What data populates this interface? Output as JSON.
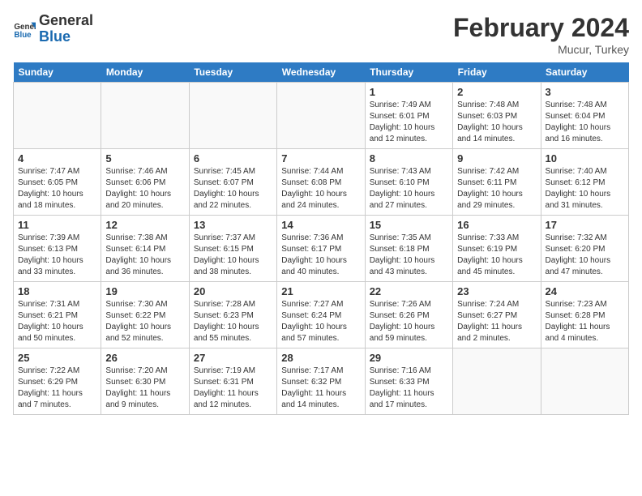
{
  "header": {
    "logo_line1": "General",
    "logo_line2": "Blue",
    "month_title": "February 2024",
    "subtitle": "Mucur, Turkey"
  },
  "days_of_week": [
    "Sunday",
    "Monday",
    "Tuesday",
    "Wednesday",
    "Thursday",
    "Friday",
    "Saturday"
  ],
  "weeks": [
    [
      {
        "day": "",
        "info": ""
      },
      {
        "day": "",
        "info": ""
      },
      {
        "day": "",
        "info": ""
      },
      {
        "day": "",
        "info": ""
      },
      {
        "day": "1",
        "info": "Sunrise: 7:49 AM\nSunset: 6:01 PM\nDaylight: 10 hours\nand 12 minutes."
      },
      {
        "day": "2",
        "info": "Sunrise: 7:48 AM\nSunset: 6:03 PM\nDaylight: 10 hours\nand 14 minutes."
      },
      {
        "day": "3",
        "info": "Sunrise: 7:48 AM\nSunset: 6:04 PM\nDaylight: 10 hours\nand 16 minutes."
      }
    ],
    [
      {
        "day": "4",
        "info": "Sunrise: 7:47 AM\nSunset: 6:05 PM\nDaylight: 10 hours\nand 18 minutes."
      },
      {
        "day": "5",
        "info": "Sunrise: 7:46 AM\nSunset: 6:06 PM\nDaylight: 10 hours\nand 20 minutes."
      },
      {
        "day": "6",
        "info": "Sunrise: 7:45 AM\nSunset: 6:07 PM\nDaylight: 10 hours\nand 22 minutes."
      },
      {
        "day": "7",
        "info": "Sunrise: 7:44 AM\nSunset: 6:08 PM\nDaylight: 10 hours\nand 24 minutes."
      },
      {
        "day": "8",
        "info": "Sunrise: 7:43 AM\nSunset: 6:10 PM\nDaylight: 10 hours\nand 27 minutes."
      },
      {
        "day": "9",
        "info": "Sunrise: 7:42 AM\nSunset: 6:11 PM\nDaylight: 10 hours\nand 29 minutes."
      },
      {
        "day": "10",
        "info": "Sunrise: 7:40 AM\nSunset: 6:12 PM\nDaylight: 10 hours\nand 31 minutes."
      }
    ],
    [
      {
        "day": "11",
        "info": "Sunrise: 7:39 AM\nSunset: 6:13 PM\nDaylight: 10 hours\nand 33 minutes."
      },
      {
        "day": "12",
        "info": "Sunrise: 7:38 AM\nSunset: 6:14 PM\nDaylight: 10 hours\nand 36 minutes."
      },
      {
        "day": "13",
        "info": "Sunrise: 7:37 AM\nSunset: 6:15 PM\nDaylight: 10 hours\nand 38 minutes."
      },
      {
        "day": "14",
        "info": "Sunrise: 7:36 AM\nSunset: 6:17 PM\nDaylight: 10 hours\nand 40 minutes."
      },
      {
        "day": "15",
        "info": "Sunrise: 7:35 AM\nSunset: 6:18 PM\nDaylight: 10 hours\nand 43 minutes."
      },
      {
        "day": "16",
        "info": "Sunrise: 7:33 AM\nSunset: 6:19 PM\nDaylight: 10 hours\nand 45 minutes."
      },
      {
        "day": "17",
        "info": "Sunrise: 7:32 AM\nSunset: 6:20 PM\nDaylight: 10 hours\nand 47 minutes."
      }
    ],
    [
      {
        "day": "18",
        "info": "Sunrise: 7:31 AM\nSunset: 6:21 PM\nDaylight: 10 hours\nand 50 minutes."
      },
      {
        "day": "19",
        "info": "Sunrise: 7:30 AM\nSunset: 6:22 PM\nDaylight: 10 hours\nand 52 minutes."
      },
      {
        "day": "20",
        "info": "Sunrise: 7:28 AM\nSunset: 6:23 PM\nDaylight: 10 hours\nand 55 minutes."
      },
      {
        "day": "21",
        "info": "Sunrise: 7:27 AM\nSunset: 6:24 PM\nDaylight: 10 hours\nand 57 minutes."
      },
      {
        "day": "22",
        "info": "Sunrise: 7:26 AM\nSunset: 6:26 PM\nDaylight: 10 hours\nand 59 minutes."
      },
      {
        "day": "23",
        "info": "Sunrise: 7:24 AM\nSunset: 6:27 PM\nDaylight: 11 hours\nand 2 minutes."
      },
      {
        "day": "24",
        "info": "Sunrise: 7:23 AM\nSunset: 6:28 PM\nDaylight: 11 hours\nand 4 minutes."
      }
    ],
    [
      {
        "day": "25",
        "info": "Sunrise: 7:22 AM\nSunset: 6:29 PM\nDaylight: 11 hours\nand 7 minutes."
      },
      {
        "day": "26",
        "info": "Sunrise: 7:20 AM\nSunset: 6:30 PM\nDaylight: 11 hours\nand 9 minutes."
      },
      {
        "day": "27",
        "info": "Sunrise: 7:19 AM\nSunset: 6:31 PM\nDaylight: 11 hours\nand 12 minutes."
      },
      {
        "day": "28",
        "info": "Sunrise: 7:17 AM\nSunset: 6:32 PM\nDaylight: 11 hours\nand 14 minutes."
      },
      {
        "day": "29",
        "info": "Sunrise: 7:16 AM\nSunset: 6:33 PM\nDaylight: 11 hours\nand 17 minutes."
      },
      {
        "day": "",
        "info": ""
      },
      {
        "day": "",
        "info": ""
      }
    ]
  ]
}
